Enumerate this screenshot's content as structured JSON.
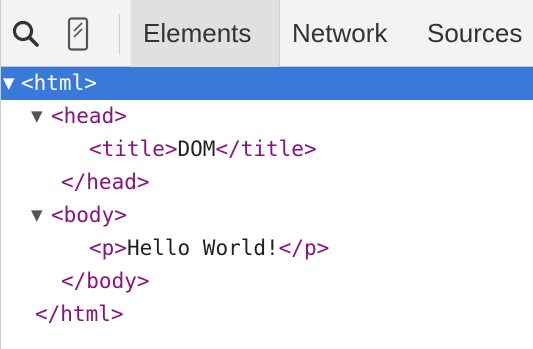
{
  "toolbar": {
    "tabs": [
      {
        "label": "Elements",
        "selected": true
      },
      {
        "label": "Network",
        "selected": false
      },
      {
        "label": "Sources",
        "selected": false
      }
    ],
    "icons": [
      "search-icon",
      "device-mode-icon"
    ]
  },
  "tree": {
    "html_open": "<html>",
    "head_open": "<head>",
    "title_open": "<title>",
    "title_text": "DOM",
    "title_close": "</title>",
    "head_close": "</head>",
    "body_open": "<body>",
    "p_open": "<p>",
    "p_text": "Hello World!",
    "p_close": "</p>",
    "body_close": "</body>",
    "html_close": "</html>",
    "expand_glyph": "▼"
  },
  "colors": {
    "tag": "#881280",
    "selection": "#3879d9",
    "toolbar_bg": "#f3f3f3"
  }
}
